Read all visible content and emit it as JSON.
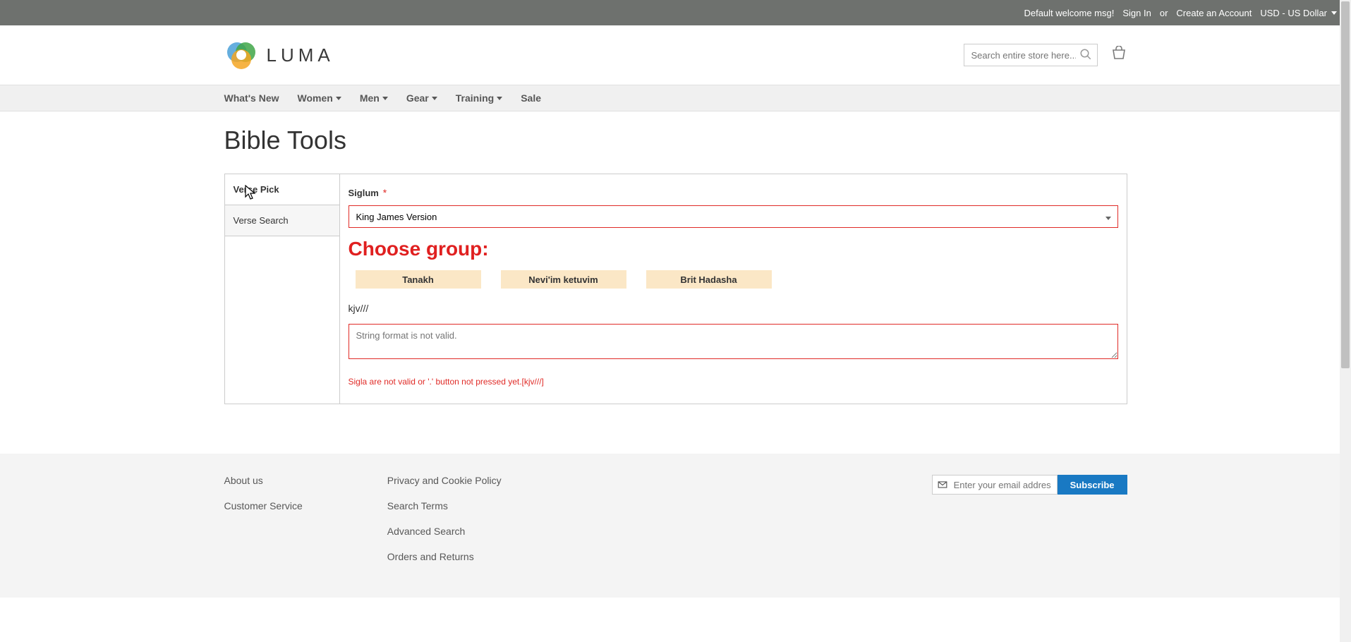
{
  "banner": {
    "welcome": "Default welcome msg!",
    "sign_in": "Sign In",
    "or": "or",
    "create_account": "Create an Account",
    "currency": "USD - US Dollar"
  },
  "header": {
    "logo_text": "LUMA",
    "search_placeholder": "Search entire store here..."
  },
  "nav": {
    "items": [
      {
        "label": "What's New",
        "has_dd": false
      },
      {
        "label": "Women",
        "has_dd": true
      },
      {
        "label": "Men",
        "has_dd": true
      },
      {
        "label": "Gear",
        "has_dd": true
      },
      {
        "label": "Training",
        "has_dd": true
      },
      {
        "label": "Sale",
        "has_dd": false
      }
    ]
  },
  "page": {
    "title": "Bible Tools",
    "tabs": {
      "verse_pick": "Verse Pick",
      "verse_search": "Verse Search"
    },
    "form": {
      "siglum_label": "Siglum",
      "siglum_value": "King James Version",
      "group_heading": "Choose group:",
      "groups": {
        "tanakh": "Tanakh",
        "neviim": "Nevi'im ketuvim",
        "brit": "Brit Hadasha"
      },
      "ref": "kjv///",
      "ta_placeholder": "String format is not valid.",
      "error": "Sigla are not valid or '.' button not pressed yet.[kjv///]"
    }
  },
  "footer": {
    "col1": {
      "about": "About us",
      "cs": "Customer Service"
    },
    "col2": {
      "privacy": "Privacy and Cookie Policy",
      "search_terms": "Search Terms",
      "adv_search": "Advanced Search",
      "orders": "Orders and Returns"
    },
    "newsletter": {
      "placeholder": "Enter your email address",
      "button": "Subscribe"
    }
  }
}
